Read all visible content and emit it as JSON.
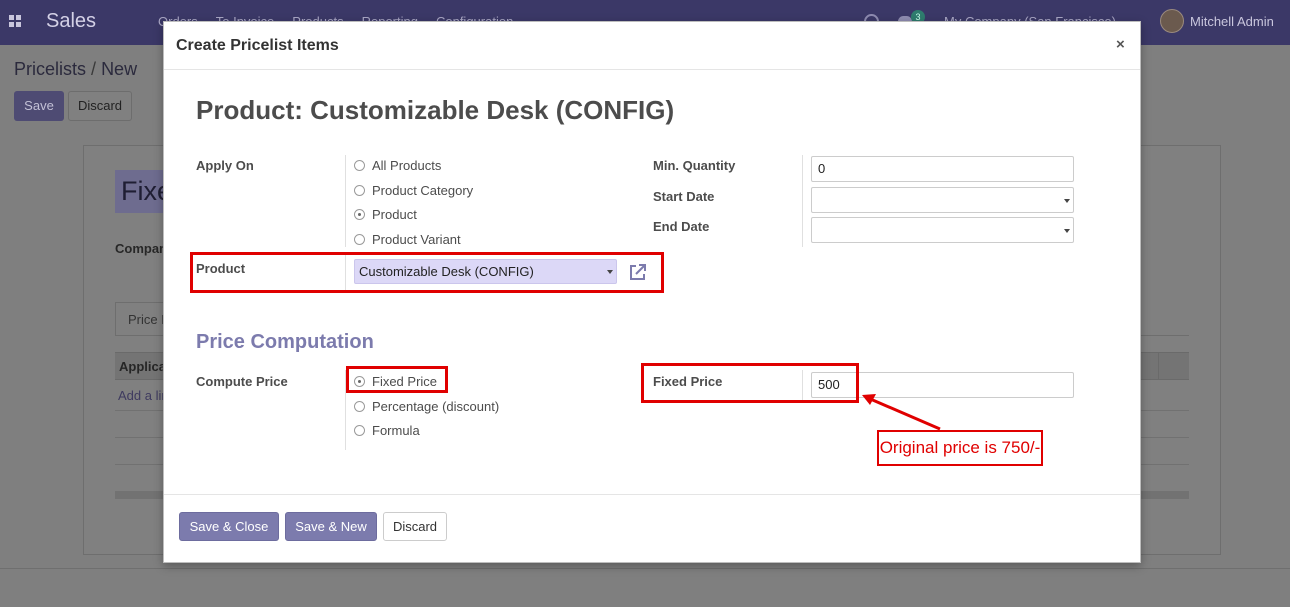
{
  "topbar": {
    "app_name": "Sales",
    "menu": [
      "Orders",
      "To Invoice",
      "Products",
      "Reporting",
      "Configuration"
    ],
    "chat_count": "3",
    "company": "My Company (San Francisco)",
    "user": "Mitchell Admin"
  },
  "background": {
    "breadcrumb_parent": "Pricelists",
    "breadcrumb_sep": "/",
    "breadcrumb_current": "New",
    "save_label": "Save",
    "discard_label": "Discard",
    "name_value": "Fixed",
    "company_label": "Company",
    "tab_label": "Price Rules",
    "table_header": "Applicable On",
    "add_line": "Add a line"
  },
  "modal": {
    "title": "Create Pricelist Items",
    "close_glyph": "×",
    "form_title": "Product: Customizable Desk (CONFIG)",
    "apply_on": {
      "label": "Apply On",
      "options": [
        "All Products",
        "Product Category",
        "Product",
        "Product Variant"
      ],
      "selected": "Product"
    },
    "min_quantity": {
      "label": "Min. Quantity",
      "value": "0"
    },
    "start_date": {
      "label": "Start Date",
      "value": ""
    },
    "end_date": {
      "label": "End Date",
      "value": ""
    },
    "product": {
      "label": "Product",
      "value": "Customizable Desk (CONFIG)"
    },
    "price_computation": {
      "title": "Price Computation",
      "compute_label": "Compute Price",
      "options": [
        "Fixed Price",
        "Percentage (discount)",
        "Formula"
      ],
      "selected": "Fixed Price"
    },
    "fixed_price": {
      "label": "Fixed Price",
      "value": "500"
    },
    "footer": {
      "save_close": "Save & Close",
      "save_new": "Save & New",
      "discard": "Discard"
    }
  },
  "annotation": {
    "text": "Original price is 750/-",
    "color": "#e00000"
  },
  "colors": {
    "brand": "#7c7bad",
    "topbar": "#3b3867",
    "product_field_bg": "#dcd8f7"
  }
}
